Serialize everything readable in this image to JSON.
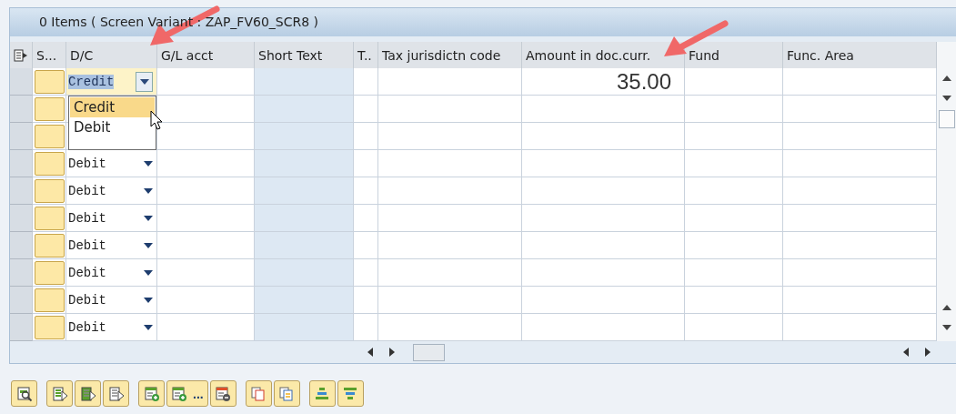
{
  "table": {
    "title": "0 Items ( Screen Variant : ZAP_FV60_SCR8 )",
    "columns": [
      "S...",
      "D/C",
      "G/L acct",
      "Short Text",
      "T..",
      "Tax jurisdictn code",
      "Amount in doc.curr.",
      "Fund",
      "Func. Area"
    ],
    "rows": [
      {
        "dc": "Credit",
        "amount": "35.00",
        "focused": true
      },
      {},
      {},
      {
        "dc": "Debit",
        "focused": false
      },
      {
        "dc": "Debit",
        "focused": false
      },
      {
        "dc": "Debit",
        "focused": false
      },
      {
        "dc": "Debit",
        "focused": false
      },
      {
        "dc": "Debit",
        "focused": false
      },
      {
        "dc": "Debit",
        "focused": false
      },
      {
        "dc": "Debit",
        "focused": false
      }
    ],
    "dropdown": {
      "options": [
        {
          "label": "Credit",
          "selected": true
        },
        {
          "label": "Debit",
          "selected": false
        }
      ]
    }
  },
  "toolbar": [
    {
      "kind": "detail"
    },
    {
      "kind": "select-all"
    },
    {
      "kind": "select-block"
    },
    {
      "kind": "deselect"
    },
    {
      "kind": "insert-row"
    },
    {
      "kind": "insert-rows",
      "label": "..."
    },
    {
      "kind": "delete-row"
    },
    {
      "kind": "copy"
    },
    {
      "kind": "paste"
    },
    {
      "kind": "sort-asc"
    },
    {
      "kind": "sort-desc"
    }
  ]
}
